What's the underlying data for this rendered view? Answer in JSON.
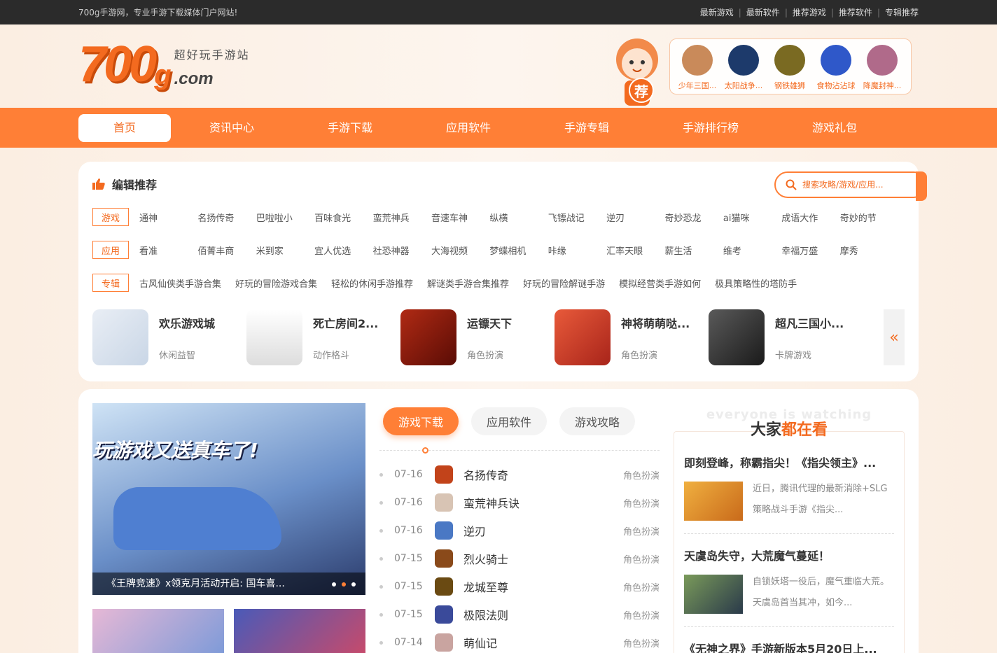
{
  "topbar": {
    "slogan": "700g手游网，专业手游下载媒体门户网站!",
    "links": [
      "最新游戏",
      "最新软件",
      "推荐游戏",
      "推荐软件",
      "专辑推荐"
    ]
  },
  "header": {
    "logo_number": "700",
    "logo_g": "g",
    "logo_slogan": "超好玩手游站",
    "logo_domain": ".com",
    "rec_badge": "荐",
    "rec_items": [
      {
        "label": "少年三国...",
        "color": "#c98a5a"
      },
      {
        "label": "太阳战争...",
        "color": "#1d3a6b"
      },
      {
        "label": "钢铁雄狮",
        "color": "#7a6a22"
      },
      {
        "label": "食物沾沾球",
        "color": "#2f58c9"
      },
      {
        "label": "降魔封神...",
        "color": "#b06a8a"
      }
    ]
  },
  "nav": {
    "items": [
      "首页",
      "资讯中心",
      "手游下载",
      "应用软件",
      "手游专辑",
      "手游排行榜",
      "游戏礼包"
    ]
  },
  "editor": {
    "title": "编辑推荐",
    "search_placeholder": "搜索攻略/游戏/应用...",
    "rows": [
      {
        "tag": "游戏",
        "links": [
          "通神",
          "名扬传奇",
          "巴啦啦小",
          "百味食光",
          "蛮荒神兵",
          "音速车神",
          "纵横",
          "飞镖战记",
          "逆刃",
          "奇妙恐龙",
          "ai猫咪",
          "成语大作",
          "奇妙的节"
        ]
      },
      {
        "tag": "应用",
        "links": [
          "看准",
          "佰菁丰商",
          "米到家",
          "宜人优选",
          "社恐神器",
          "大海视频",
          "梦蝶相机",
          "咔缘",
          "汇率天眼",
          "薪生活",
          "维考",
          "幸福万盛",
          "摩秀"
        ]
      },
      {
        "tag": "专辑",
        "links": [
          "古风仙侠类手游合集",
          "好玩的冒险游戏合集",
          "轻松的休闲手游推荐",
          "解谜类手游合集推荐",
          "好玩的冒险解谜手游",
          "模拟经营类手游如何",
          "极具策略性的塔防手"
        ]
      }
    ],
    "cards": [
      {
        "name": "欢乐游戏城",
        "cat": "休闲益智",
        "color": "#e9eef5"
      },
      {
        "name": "死亡房间2...",
        "cat": "动作格斗",
        "color": "#f5f5f5"
      },
      {
        "name": "运镖天下",
        "cat": "角色扮演",
        "color": "#8b1a0f"
      },
      {
        "name": "神将萌萌哒...",
        "cat": "角色扮演",
        "color": "#d9452b"
      },
      {
        "name": "超凡三国小...",
        "cat": "卡牌游戏",
        "color": "#3a3a3a"
      }
    ],
    "arrow": "«"
  },
  "banner": {
    "title": "玩游戏又送真车了!",
    "caption": "《王牌竞速》x领克月活动开启: 国车喜..."
  },
  "tabs": [
    "游戏下载",
    "应用软件",
    "游戏攻略"
  ],
  "game_list": [
    {
      "date": "07-16",
      "name": "名扬传奇",
      "cat": "角色扮演",
      "color": "#c2431a"
    },
    {
      "date": "07-16",
      "name": "蛮荒神兵诀",
      "cat": "角色扮演",
      "color": "#d8c4b4"
    },
    {
      "date": "07-16",
      "name": "逆刃",
      "cat": "角色扮演",
      "color": "#4a78c4"
    },
    {
      "date": "07-15",
      "name": "烈火骑士",
      "cat": "角色扮演",
      "color": "#8a4a1a"
    },
    {
      "date": "07-15",
      "name": "龙城至尊",
      "cat": "角色扮演",
      "color": "#6a4a12"
    },
    {
      "date": "07-15",
      "name": "极限法则",
      "cat": "角色扮演",
      "color": "#3a4a9a"
    },
    {
      "date": "07-14",
      "name": "萌仙记",
      "cat": "角色扮演",
      "color": "#c9a4a0"
    }
  ],
  "watching": {
    "en": "everyone is watching",
    "cn_a": "大家",
    "cn_b": "都在看",
    "articles": [
      {
        "title": "即刻登峰，称霸指尖！《指尖领主》...",
        "desc": "近日，腾讯代理的最新消除+SLG策略战斗手游《指尖...",
        "color": "#e0962a"
      },
      {
        "title": "天虞岛失守，大荒魔气蔓延！",
        "desc": "自锁妖塔一役后，魔气重临大荒。 天虞岛首当其冲，如今...",
        "color": "#5a7a4a"
      },
      {
        "title": "《无神之界》手游新版本5月20日上...",
        "desc": "",
        "color": "#999"
      }
    ]
  }
}
